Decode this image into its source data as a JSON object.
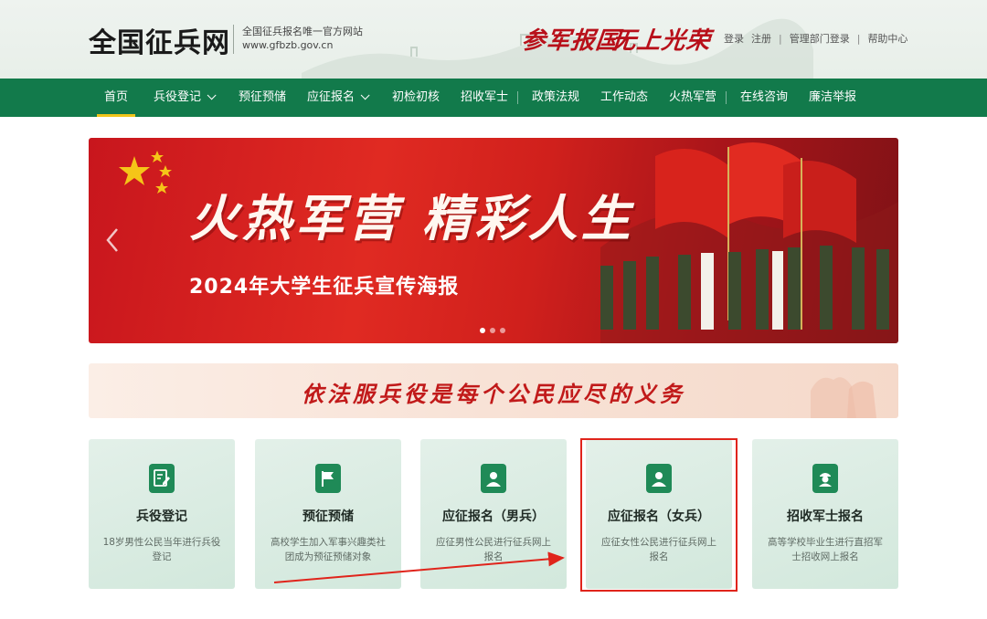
{
  "header": {
    "logo": "全国征兵网",
    "subtitle": "全国征兵报名唯一官方网站",
    "domain": "www.gfbzb.gov.cn",
    "slogan_1": "参军报国",
    "slogan_2": "无上光荣",
    "links": {
      "login": "登录",
      "register": "注册",
      "admin_login": "管理部门登录",
      "help": "帮助中心"
    }
  },
  "nav": {
    "items": [
      "首页",
      "兵役登记",
      "预征预储",
      "应征报名",
      "初检初核",
      "招收军士",
      "政策法规",
      "工作动态",
      "火热军营",
      "在线咨询",
      "廉洁举报"
    ],
    "active_index": 0
  },
  "banner": {
    "title": "火热军营 精彩人生",
    "subtitle": "2024年大学生征兵宣传海报",
    "slide_count": 3,
    "active_slide": 0
  },
  "motto": "依法服兵役是每个公民应尽的义务",
  "cards": [
    {
      "title": "兵役登记",
      "desc": "18岁男性公民当年进行兵役登记",
      "icon": "edit-form-icon"
    },
    {
      "title": "预征预储",
      "desc": "高校学生加入军事兴趣类社团成为预征预储对象",
      "icon": "flag-icon"
    },
    {
      "title": "应征报名（男兵）",
      "desc": "应征男性公民进行征兵网上报名",
      "icon": "person-icon"
    },
    {
      "title": "应征报名（女兵）",
      "desc": "应征女性公民进行征兵网上报名",
      "icon": "person-icon"
    },
    {
      "title": "招收军士报名",
      "desc": "高等学校毕业生进行直招军士招收网上报名",
      "icon": "soldier-icon"
    }
  ],
  "colors": {
    "nav_green": "#127a4b",
    "accent_red": "#c11a1a",
    "active_underline": "#f0c419"
  }
}
